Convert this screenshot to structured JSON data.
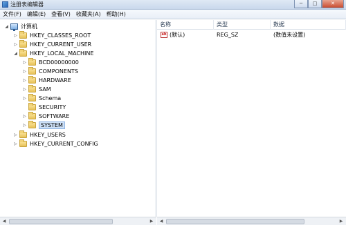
{
  "window": {
    "title": "注册表编辑器",
    "controls": [
      "─",
      "□",
      "✕"
    ]
  },
  "menu": [
    "文件(F)",
    "编辑(E)",
    "查看(V)",
    "收藏夹(A)",
    "帮助(H)"
  ],
  "tree": {
    "root": "计算机",
    "hives": [
      "HKEY_CLASSES_ROOT",
      "HKEY_CURRENT_USER",
      "HKEY_LOCAL_MACHINE",
      "HKEY_USERS",
      "HKEY_CURRENT_CONFIG"
    ],
    "hklm_children": [
      "BCD00000000",
      "COMPONENTS",
      "HARDWARE",
      "SAM",
      "Schema",
      "SECURITY",
      "SOFTWARE",
      "SYSTEM"
    ],
    "selected": "SYSTEM"
  },
  "list": {
    "columns": [
      "名称",
      "类型",
      "数据"
    ],
    "rows": [
      {
        "icon": "ab",
        "name": "(默认)",
        "type": "REG_SZ",
        "data": "(数值未设置)"
      }
    ]
  },
  "icons": {
    "expand": "▷",
    "collapse": "◢",
    "scroll_left": "◀",
    "scroll_right": "▶"
  }
}
